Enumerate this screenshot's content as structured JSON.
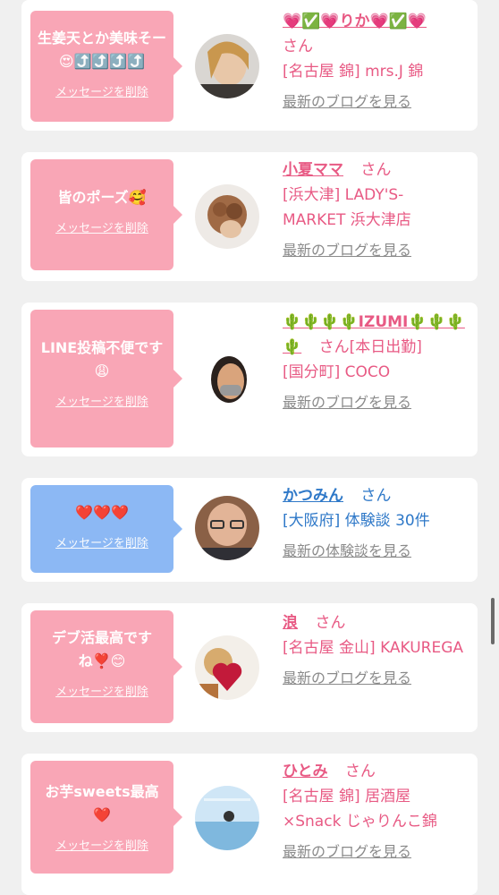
{
  "entries": [
    {
      "message": "生姜天とか美味そー😍⤴️⤴️⤴️⤴️",
      "delete_label": "メッセージを削除",
      "name": "💗✅💗りか💗✅💗",
      "san": "さん",
      "location": "[名古屋 錦] mrs.J 錦",
      "link": "最新のブログを見る"
    },
    {
      "message": "皆のポーズ🥰",
      "delete_label": "メッセージを削除",
      "name": "小夏ママ",
      "san": "さん",
      "location": "[浜大津] LADY'S-MARKET 浜大津店",
      "link": "最新のブログを見る"
    },
    {
      "message": "LINE投稿不便です😩",
      "delete_label": "メッセージを削除",
      "name": "🌵🌵🌵🌵IZUMI🌵🌵🌵🌵",
      "san": "さん[本日出勤]",
      "location": "[国分町] COCO",
      "link": "最新のブログを見る"
    },
    {
      "message": "❤️❤️❤️",
      "delete_label": "メッセージを削除",
      "name": "かつみん",
      "san": "さん",
      "location": "[大阪府] 体験談 30件",
      "link": "最新の体験談を見る"
    },
    {
      "message": "デブ活最高ですね❣️😊",
      "delete_label": "メッセージを削除",
      "name": "浪",
      "san": "さん",
      "location": "[名古屋 金山] KAKUREGA",
      "link": "最新のブログを見る"
    },
    {
      "message": "お芋sweets最高❤️",
      "delete_label": "メッセージを削除",
      "name": "ひとみ",
      "san": "さん",
      "location": "[名古屋 錦] 居酒屋×Snack じゃりんこ錦",
      "link": "最新のブログを見る"
    }
  ]
}
